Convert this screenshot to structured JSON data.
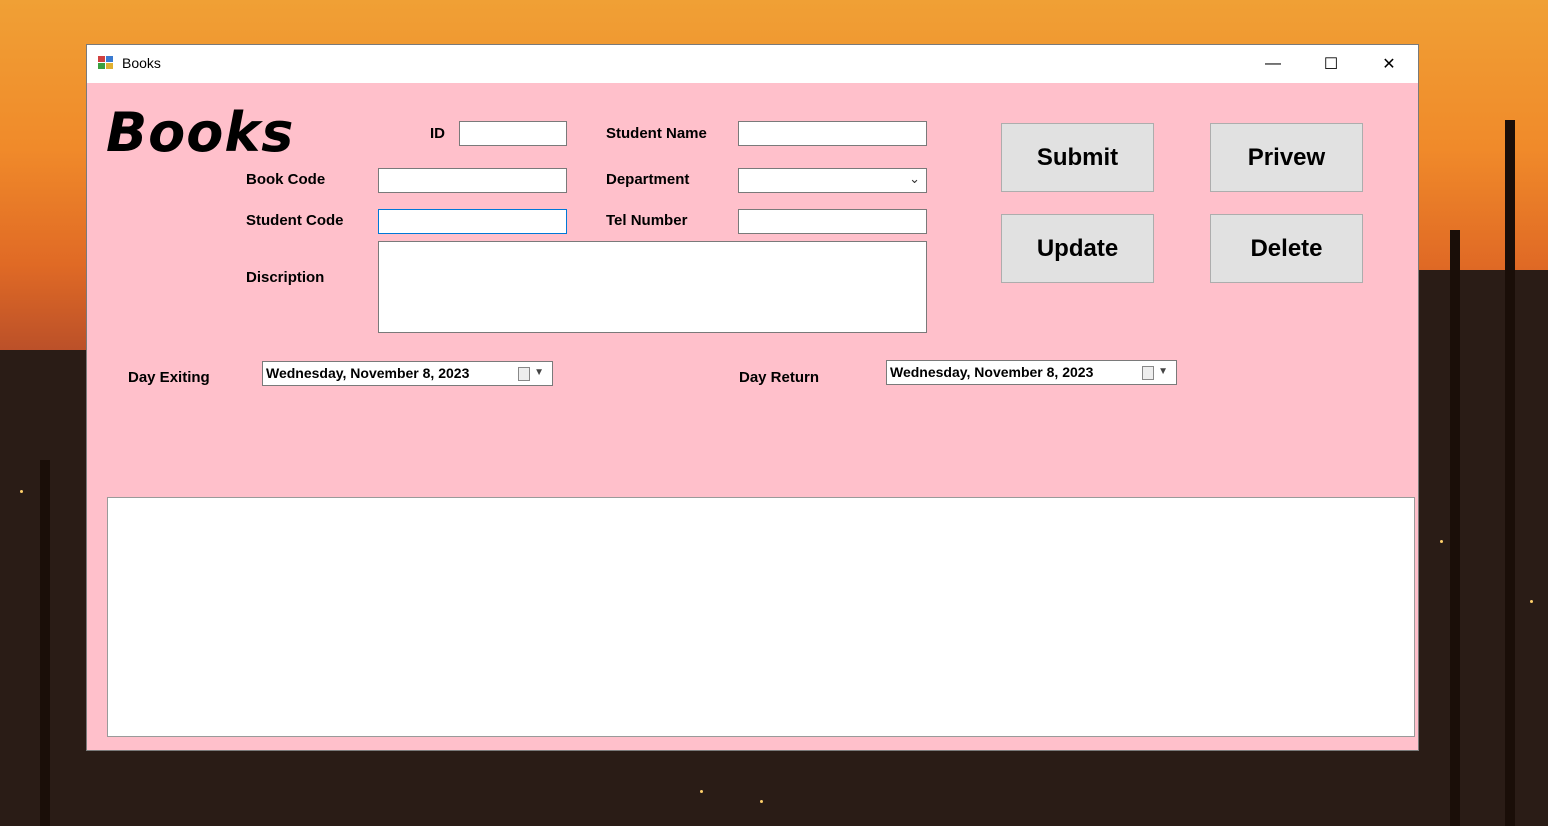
{
  "window": {
    "title": "Books",
    "controls": {
      "minimize": "—",
      "maximize": "☐",
      "close": "✕"
    },
    "background_color": "#ffc0cb"
  },
  "form": {
    "heading": "Books",
    "labels": {
      "id": "ID",
      "student_name": "Student Name",
      "book_code": "Book Code",
      "department": "Department",
      "student_code": "Student Code",
      "tel_number": "Tel Number",
      "description": "Discription",
      "day_exiting": "Day Exiting",
      "day_return": "Day Return"
    },
    "values": {
      "id": "",
      "student_name": "",
      "book_code": "",
      "department": "",
      "student_code": "",
      "tel_number": "",
      "description": "",
      "day_exiting": "Wednesday,  November    8, 2023",
      "day_return": "Wednesday,  November    8, 2023"
    }
  },
  "buttons": {
    "submit": "Submit",
    "preview": "Privew",
    "update": "Update",
    "delete": "Delete"
  },
  "icons": {
    "app": "app-window-icon",
    "combo": "chevron-down-icon",
    "calendar": "calendar-icon"
  }
}
